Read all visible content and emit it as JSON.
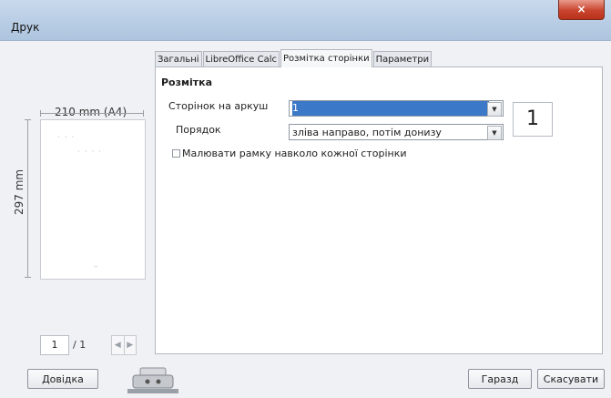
{
  "window": {
    "title": "Друк",
    "close_glyph": "×"
  },
  "preview": {
    "width_label": "210 mm (A4)",
    "height_label": "297 mm",
    "page_input": "1",
    "page_total": "/ 1",
    "prev_icon": "chevron-left-icon",
    "next_icon": "chevron-right-icon"
  },
  "tabs": [
    {
      "label": "Загальні",
      "active": false
    },
    {
      "label": "LibreOffice Calc",
      "active": false
    },
    {
      "label": "Розмітка сторінки",
      "active": true
    },
    {
      "label": "Параметри",
      "active": false
    }
  ],
  "layout": {
    "section_title": "Розмітка",
    "pages_per_sheet_label": "Сторінок на аркуш",
    "pages_per_sheet_value": "1",
    "order_label": "Порядок",
    "order_value": "зліва направо, потім донизу",
    "pages_count_display": "1",
    "border_checkbox_label": "Малювати рамку навколо кожної сторінки",
    "border_checked": false
  },
  "buttons": {
    "help": "Довідка",
    "ok": "Гаразд",
    "cancel": "Скасувати"
  },
  "colors": {
    "selection": "#3b78c8",
    "close": "#c9442e"
  }
}
